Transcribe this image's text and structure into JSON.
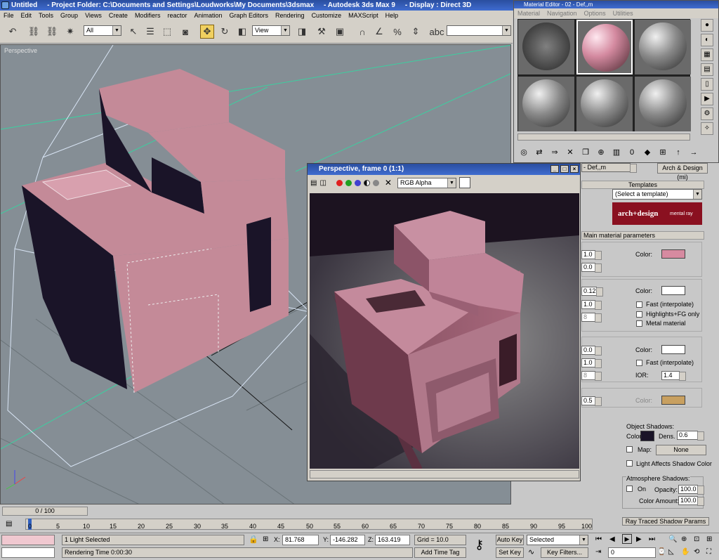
{
  "app": {
    "title": "Untitled     - Project Folder: C:\\Documents and Settings\\Loudworks\\My Documents\\3dsmax     - Autodesk 3ds Max 9     - Display : Direct 3D"
  },
  "menu": [
    "File",
    "Edit",
    "Tools",
    "Group",
    "Views",
    "Create",
    "Modifiers",
    "reactor",
    "Animation",
    "Graph Editors",
    "Rendering",
    "Customize",
    "MAXScript",
    "Help"
  ],
  "toolbar": {
    "selection_filter": "All",
    "ref_coord": "View"
  },
  "viewport": {
    "label": "Perspective"
  },
  "material_editor": {
    "title": "Material Editor - 02 - Def,,m",
    "menu": [
      "Material",
      "Navigation",
      "Options",
      "Utilities"
    ],
    "material_name": "- Def,,m",
    "material_type": "Arch & Design (mi)",
    "templates_label": "Templates",
    "template_select": "(Select a template)",
    "banner_main": "arch+design",
    "banner_sub": "mental ray",
    "main_params": "Main material parameters",
    "diffuse_level": "1.0",
    "roughness": "0.0",
    "color_label": "Color:",
    "diffuse_color": "#d68aa0",
    "refl_level": "0.12",
    "refl_gloss": "1.0",
    "refl_samples": "8",
    "refl_color": "#ffffff",
    "fast_interp": "Fast (interpolate)",
    "highlights_fg": "Highlights+FG only",
    "metal_mat": "Metal material",
    "refr_trans": "0.0",
    "refr_gloss": "1.0",
    "refr_samples": "8",
    "refr_color": "#ffffff",
    "fast_interp2": "Fast (interpolate)",
    "ior_label": "IOR:",
    "ior": "1.4",
    "aniso_val": "0.5",
    "color_label2": "Color:",
    "tan_color": "#c8a060"
  },
  "render_frame": {
    "title": "Perspective, frame 0 (1:1)",
    "channel": "RGB Alpha"
  },
  "shadow_panel": {
    "object_shadows": "Object Shadows:",
    "color_label": "Color:",
    "shadow_color": "#1a1428",
    "dens_label": "Dens.",
    "dens": "0.6",
    "map_label": "Map:",
    "map_btn": "None",
    "light_affects": "Light Affects Shadow Color",
    "atmo_title": "Atmosphere Shadows:",
    "on_label": "On",
    "opacity_label": "Opacity:",
    "opacity": "100.0",
    "color_amount_label": "Color Amount:",
    "color_amount": "100.0",
    "rollout": "Ray Traced Shadow Params"
  },
  "time": {
    "slider": "0 / 100",
    "ticks": [
      "0",
      "5",
      "10",
      "15",
      "20",
      "25",
      "30",
      "35",
      "40",
      "45",
      "50",
      "55",
      "60",
      "65",
      "70",
      "75",
      "80",
      "85",
      "90",
      "95",
      "100"
    ]
  },
  "status": {
    "selection": "1 Light Selected",
    "prompt": "Rendering Time  0:00:30",
    "x_label": "X:",
    "x": "81.768",
    "y_label": "Y:",
    "y": "-146.282",
    "z_label": "Z:",
    "z": "163.419",
    "grid": "Grid = 10.0",
    "add_time_tag": "Add Time Tag",
    "auto_key": "Auto Key",
    "set_key": "Set Key",
    "key_mode": "Selected",
    "key_filters": "Key Filters...",
    "frame": "0"
  }
}
